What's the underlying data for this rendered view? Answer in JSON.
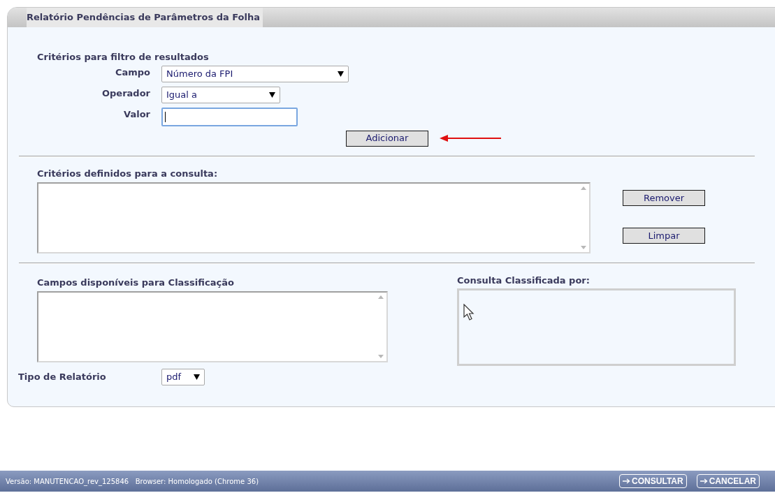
{
  "title": "Relatório Pendências de Parâmetros da Folha",
  "filter": {
    "heading": "Critérios para filtro de resultados",
    "fields": [
      {
        "label": "Campo",
        "kind": "select",
        "value": "Número da FPI"
      },
      {
        "label": "Operador",
        "kind": "select",
        "value": "Igual a"
      },
      {
        "label": "Valor",
        "kind": "input",
        "focused": true
      }
    ],
    "add_button": "Adicionar"
  },
  "criteria": {
    "heading": "Critérios definidos para a consulta:",
    "buttons": [
      "Remover",
      "Limpar"
    ]
  },
  "sorting": {
    "available_heading": "Campos disponíveis para Classificação",
    "sorted_heading": "Consulta Classificada por:"
  },
  "report_type": {
    "label": "Tipo de Relatório",
    "value": "pdf"
  },
  "footer": {
    "version": "Versão: MANUTENCAO_rev_125846   Browser: Homologado (Chrome 36)",
    "buttons": [
      "CONSULTAR",
      "CANCELAR"
    ]
  }
}
